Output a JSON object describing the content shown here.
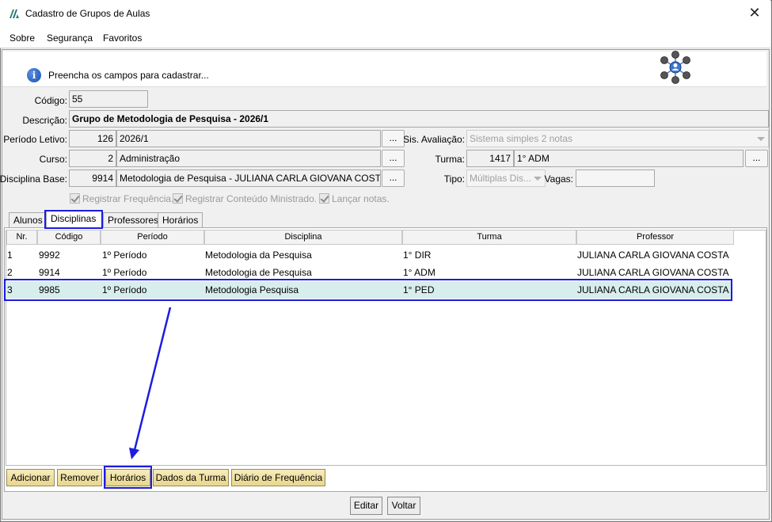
{
  "window": {
    "title": "Cadastro de Grupos de Aulas",
    "close": "✕"
  },
  "menu": [
    {
      "label": "Sobre"
    },
    {
      "label": "Segurança"
    },
    {
      "label": "Favoritos"
    }
  ],
  "info": {
    "icon": "i",
    "message": "Preencha os campos para cadastrar..."
  },
  "form": {
    "codigo_label": "Código:",
    "codigo": "55",
    "descricao_label": "Descrição:",
    "descricao": "Grupo de Metodologia de Pesquisa - 2026/1",
    "periodo_label": "Período Letivo:",
    "periodo_id": "126",
    "periodo": "2026/1",
    "sis_avaliacao_label": "Sis. Avaliação:",
    "sis_avaliacao": "Sistema simples 2 notas",
    "curso_label": "Curso:",
    "curso_id": "2",
    "curso": "Administração",
    "turma_label": "Turma:",
    "turma_id": "1417",
    "turma": "1° ADM",
    "disciplina_label": "Disciplina Base:",
    "disciplina_id": "9914",
    "disciplina": "Metodologia de Pesquisa - JULIANA CARLA GIOVANA COSTA",
    "tipo_label": "Tipo:",
    "tipo": "Múltiplas Dis...",
    "vagas_label": "Vagas:",
    "vagas": "",
    "dots": "...",
    "chk_frequencia": "Registrar Frequência.",
    "chk_conteudo": "Registrar Conteúdo Ministrado.",
    "chk_notas": "Lançar notas."
  },
  "tabs": [
    {
      "label": "Alunos"
    },
    {
      "label": "Disciplinas"
    },
    {
      "label": "Professores"
    },
    {
      "label": "Horários"
    }
  ],
  "table": {
    "headers": [
      "Nr.",
      "Código",
      "Período",
      "Disciplina",
      "Turma",
      "Professor"
    ],
    "rows": [
      {
        "nr": "1",
        "codigo": "9992",
        "periodo": "1º Período",
        "disciplina": "Metodologia da Pesquisa",
        "turma": "1° DIR",
        "professor": "JULIANA CARLA GIOVANA COSTA"
      },
      {
        "nr": "2",
        "codigo": "9914",
        "periodo": "1º Período",
        "disciplina": "Metodologia de Pesquisa",
        "turma": "1° ADM",
        "professor": "JULIANA CARLA GIOVANA COSTA"
      },
      {
        "nr": "3",
        "codigo": "9985",
        "periodo": "1º Período",
        "disciplina": "Metodologia Pesquisa",
        "turma": "1° PED",
        "professor": "JULIANA CARLA GIOVANA COSTA"
      }
    ]
  },
  "actions": {
    "adicionar": "Adicionar",
    "remover": "Remover",
    "horarios": "Horários",
    "dados_turma": "Dados da Turma",
    "diario": "Diário de Frequência"
  },
  "footer": {
    "editar": "Editar",
    "voltar": "Voltar"
  },
  "colors": {
    "highlight": "#1c1ce0",
    "selected_row": "#d8eded",
    "action_button": "#f0e0a0"
  }
}
